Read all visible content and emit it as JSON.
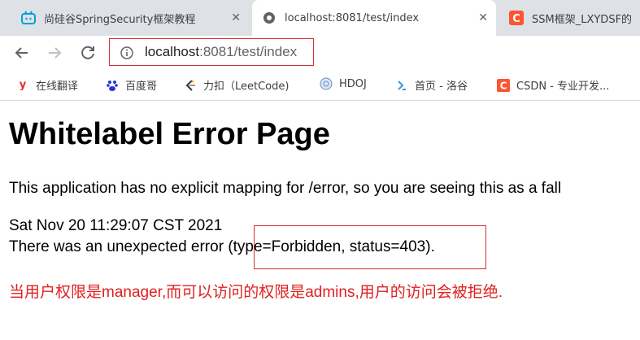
{
  "browser": {
    "tabs": [
      {
        "title": "尚硅谷SpringSecurity框架教程",
        "icon": "bilibili-icon",
        "close": "✕"
      },
      {
        "title": "localhost:8081/test/index",
        "icon": "globe-icon",
        "close": "✕"
      },
      {
        "title": "SSM框架_LXYDSF的",
        "icon": "csdn-icon"
      }
    ],
    "address": {
      "host": "localhost",
      "path": ":8081/test/index"
    },
    "bookmarks": [
      {
        "label": "在线翻译",
        "icon": "youdao-icon"
      },
      {
        "label": "百度哥",
        "icon": "baidu-icon"
      },
      {
        "label": "力扣（LeetCode)",
        "icon": "leetcode-icon"
      },
      {
        "label": "HDOJ",
        "icon": "hdoj-icon"
      },
      {
        "label": "首页 - 洛谷",
        "icon": "luogu-icon"
      },
      {
        "label": "CSDN - 专业开发...",
        "icon": "csdn-icon"
      }
    ]
  },
  "page": {
    "title": "Whitelabel Error Page",
    "description": "This application has no explicit mapping for /error, so you are seeing this as a fall",
    "timestamp": "Sat Nov 20 11:29:07 CST 2021",
    "error_prefix": "There was an unexpected error ",
    "error_detail": "(type=Forbidden, status=403)",
    "error_suffix": ".",
    "annotation": "当用户权限是manager,而可以访问的权限是admins,用户的访问会被拒绝."
  },
  "colors": {
    "highlight_box": "#d32f2f",
    "annotation_text": "#e02020",
    "tabstrip": "#dee1e6"
  }
}
